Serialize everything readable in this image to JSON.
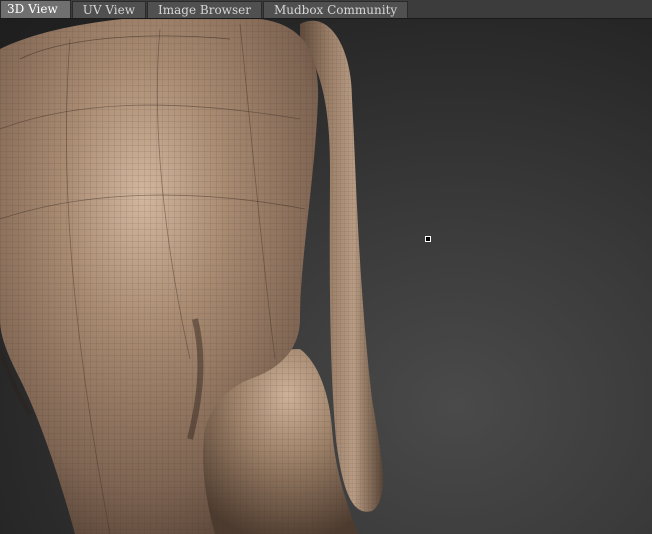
{
  "tabs": [
    {
      "label": "3D View",
      "active": true
    },
    {
      "label": "UV View",
      "active": false
    },
    {
      "label": "Image Browser",
      "active": false
    },
    {
      "label": "Mudbox Community",
      "active": false
    }
  ],
  "colors": {
    "skin": "#9c8068",
    "skin_light": "#c6ab91",
    "skin_dark": "#5a4536",
    "background": "#2a2a2a"
  }
}
